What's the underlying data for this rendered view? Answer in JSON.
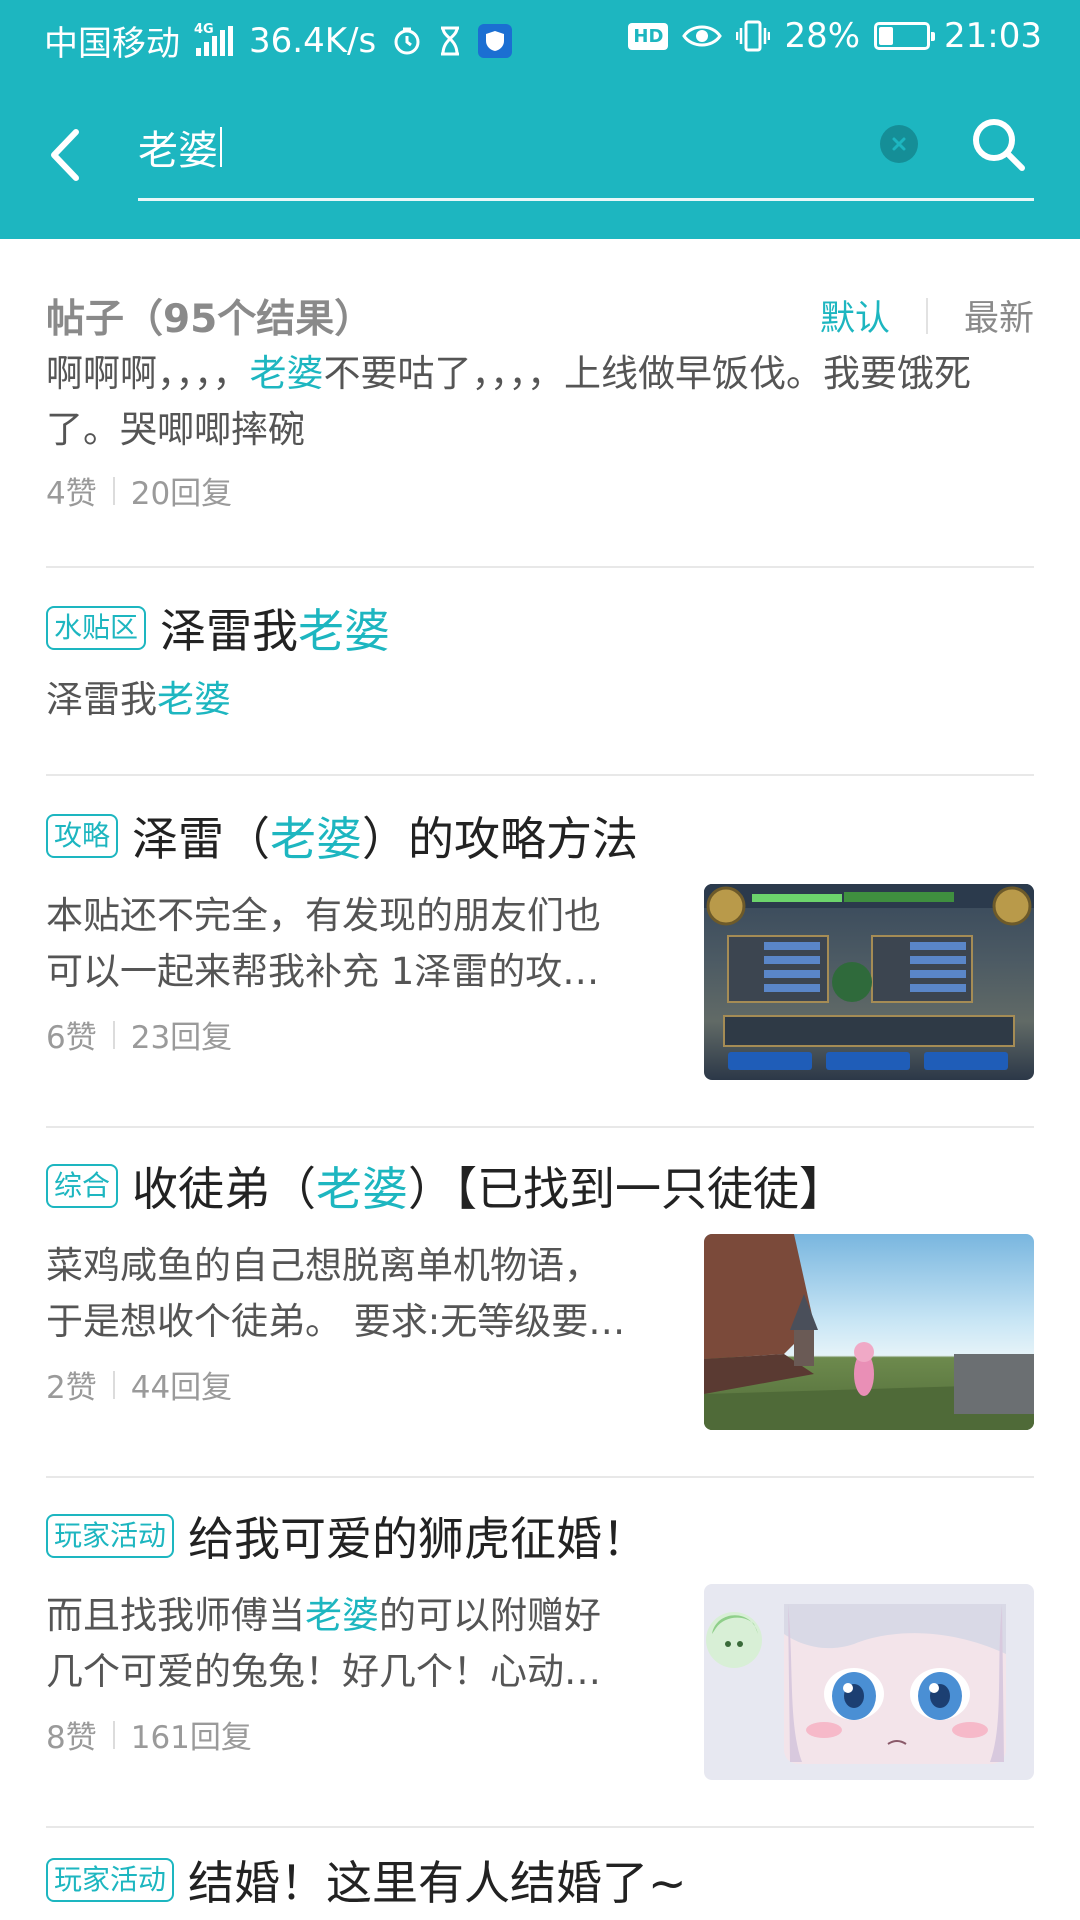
{
  "status_bar": {
    "carrier": "中国移动",
    "network": "4G",
    "speed": "36.4K/s",
    "battery": "28%",
    "battery_level": 0.28,
    "time": "21:03",
    "hd_label": "HD",
    "icons": [
      "signal-icon",
      "alarm-clock-icon",
      "hourglass-icon",
      "shield-icon",
      "eye-icon",
      "vibrate-icon",
      "battery-icon"
    ]
  },
  "search": {
    "query": "老婆"
  },
  "results": {
    "title": "帖子（95个结果）",
    "sort_default": "默认",
    "sort_latest": "最新"
  },
  "posts": [
    {
      "tag": "",
      "title": "",
      "body_before": "啊啊啊，，，，",
      "body_highlight": "老婆",
      "body_after": "不要咕了，，，，上线做早饭伐。我要饿死了。哭唧唧摔碗",
      "likes": "4赞",
      "replies": "20回复"
    },
    {
      "tag": "水贴区",
      "title_before": "泽雷我",
      "title_highlight": "老婆",
      "title_after": "",
      "body_before": "泽雷我",
      "body_highlight": "老婆",
      "body_after": ""
    },
    {
      "tag": "攻略",
      "title_before": "泽雷（",
      "title_highlight": "老婆",
      "title_after": "）的攻略方法",
      "body_line1": "本贴还不完全，有发现的朋友们也",
      "body_line2": "可以一起来帮我补充 1泽雷的攻…",
      "likes": "6赞",
      "replies": "23回复"
    },
    {
      "tag": "综合",
      "title_before": "收徒弟（",
      "title_highlight": "老婆",
      "title_after": "）【已找到一只徒徒】",
      "body_line1": "菜鸡咸鱼的自己想脱离单机物语，",
      "body_line2": "于是想收个徒弟。 要求:无等级要…",
      "likes": "2赞",
      "replies": "44回复"
    },
    {
      "tag": "玩家活动",
      "title": "给我可爱的狮虎征婚！",
      "body_before": "而且找我师傅当",
      "body_highlight": "老婆",
      "body_after": "的可以附赠好",
      "body_line2": "几个可爱的兔兔！好几个！心动…",
      "likes": "8赞",
      "replies": "161回复"
    },
    {
      "tag": "玩家活动",
      "title": "结婚！这里有人结婚了~"
    }
  ],
  "colors": {
    "accent": "#1db6c0",
    "header_bg": "#1db6c0"
  }
}
